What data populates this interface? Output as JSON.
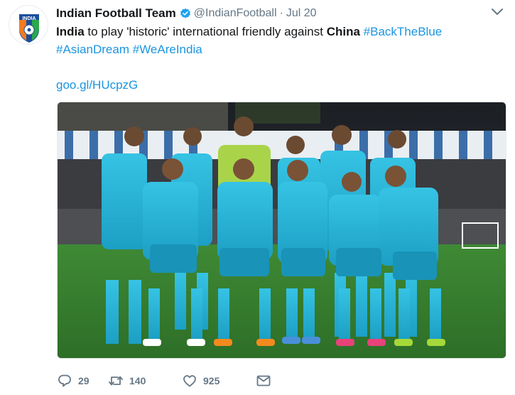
{
  "tweet": {
    "author": {
      "name": "Indian Football Team",
      "handle": "@IndianFootball",
      "verified": true,
      "avatar_text": "INDIA"
    },
    "separator": "·",
    "date": "Jul 20",
    "text": {
      "w1": "India",
      "w2": " to play 'historic' international friendly against ",
      "w3": "China",
      "tag1": "#BackTheBlue",
      "tag2": "#AsianDream",
      "tag3": "#WeAreIndia"
    },
    "link": "goo.gl/HUcpzG",
    "photo_icon": "team-photo-image",
    "actions": {
      "replies": "29",
      "retweets": "140",
      "likes": "925"
    },
    "colors": {
      "link": "#1b95e0",
      "muted": "#657786",
      "verified": "#1da1f2",
      "jersey": "#2ab6d8"
    }
  }
}
